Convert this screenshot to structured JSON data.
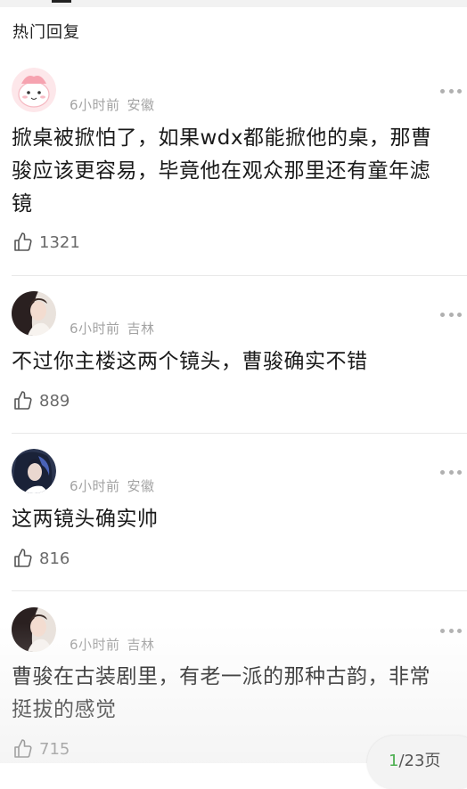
{
  "section": {
    "title": "热门回复"
  },
  "comments": [
    {
      "time": "6小时前",
      "location": "安徽",
      "text_lines": [
        "掀桌被掀怕了，如果wdx都能掀他的桌，那曹",
        "骏应该更容易，毕竟他在观众那里还有童年滤",
        "镜"
      ],
      "likes": "1321",
      "avatar": "pink-cartoon-avatar"
    },
    {
      "time": "6小时前",
      "location": "吉林",
      "text_lines": [
        "不过你主楼这两个镜头，曹骏确实不错"
      ],
      "likes": "889",
      "avatar": "person-photo-avatar"
    },
    {
      "time": "6小时前",
      "location": "安徽",
      "text_lines": [
        "这两镜头确实帅"
      ],
      "likes": "816",
      "avatar": "dark-hair-photo-avatar"
    },
    {
      "time": "6小时前",
      "location": "吉林",
      "text_lines": [
        "曹骏在古装剧里，有老一派的那种古韵，非常",
        "挺拔的感觉"
      ],
      "likes": "715",
      "avatar": "person-photo-avatar"
    }
  ],
  "pagination": {
    "current": "1",
    "total_suffix": "/23页"
  },
  "icons": {
    "like": "thumbs-up-icon",
    "more": "more-dots-icon"
  },
  "colors": {
    "meta": "#a3a3a3",
    "page_current": "#4caf50"
  }
}
